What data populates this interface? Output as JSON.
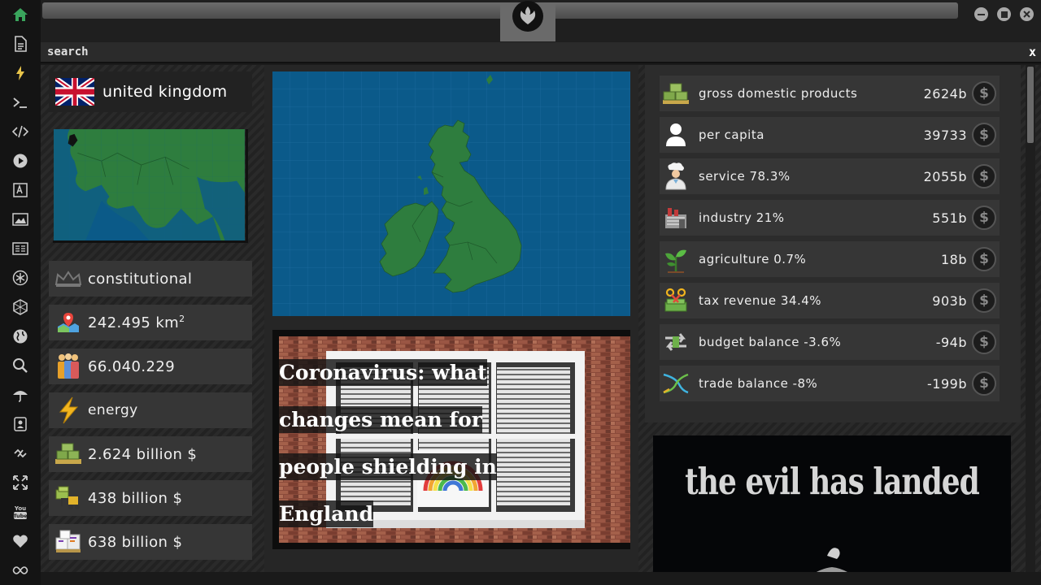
{
  "sidebar": {
    "icons": [
      "home-icon",
      "document-icon",
      "lightning-icon",
      "terminal-icon",
      "code-icon",
      "play-icon",
      "translate-icon",
      "image-icon",
      "newspaper-icon",
      "asterisk-icon",
      "hexagon-icon",
      "globe-icon",
      "search-icon",
      "umbrella-icon",
      "contact-icon",
      "link-icon",
      "expand-icon",
      "youtube-icon",
      "heart-icon",
      "infinity-icon"
    ]
  },
  "searchbar": {
    "label": "search",
    "close": "x"
  },
  "country": {
    "name": "united kingdom"
  },
  "stats": [
    {
      "icon": "crown-icon",
      "text": "constitutional"
    },
    {
      "icon": "area-map-icon",
      "text": "242.495 km",
      "sup": "2"
    },
    {
      "icon": "population-icon",
      "text": "66.040.229"
    },
    {
      "icon": "energy-icon",
      "text": "energy"
    },
    {
      "icon": "money-stack-icon",
      "text": "2.624 billion $"
    },
    {
      "icon": "forklift-money-icon",
      "text": "438 billion $"
    },
    {
      "icon": "boxes-icon",
      "text": "638 billion $"
    }
  ],
  "news": {
    "headline": "Coronavirus: what changes mean for people shielding in England"
  },
  "economy": [
    {
      "icon": "money-pallet-icon",
      "label": "gross domestic products",
      "value": "2624b"
    },
    {
      "icon": "person-icon",
      "label": "per capita",
      "value": "39733"
    },
    {
      "icon": "chef-icon",
      "label": "service 78.3%",
      "value": "2055b"
    },
    {
      "icon": "factory-icon",
      "label": "industry 21%",
      "value": "551b"
    },
    {
      "icon": "plant-icon",
      "label": "agriculture 0.7%",
      "value": "18b"
    },
    {
      "icon": "tax-scissors-icon",
      "label": "tax revenue 34.4%",
      "value": "903b"
    },
    {
      "icon": "balance-arrows-icon",
      "label": "budget balance -3.6%",
      "value": "-94b"
    },
    {
      "icon": "trade-cross-icon",
      "label": "trade balance -8%",
      "value": "-199b"
    }
  ],
  "dollar_symbol": "$",
  "poster": {
    "title": "the evil has landed"
  },
  "colors": {
    "accent_green": "#3aa55d",
    "map_sea": "#0b5a8a",
    "map_land": "#2e7d3e"
  }
}
